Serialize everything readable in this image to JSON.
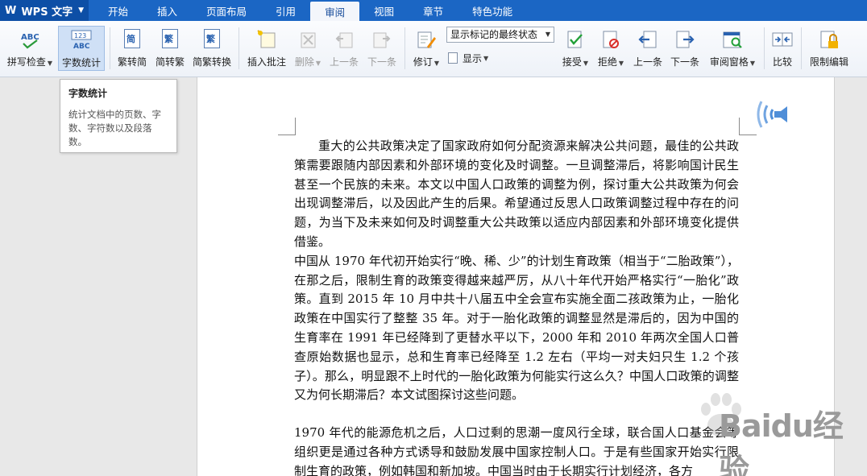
{
  "app": {
    "name": "WPS 文字",
    "logo": "W"
  },
  "menu_tabs": [
    {
      "label": "开始"
    },
    {
      "label": "插入"
    },
    {
      "label": "页面布局"
    },
    {
      "label": "引用"
    },
    {
      "label": "审阅"
    },
    {
      "label": "视图"
    },
    {
      "label": "章节"
    },
    {
      "label": "特色功能"
    }
  ],
  "active_tab": "审阅",
  "ribbon": {
    "spell_check": "拼写检查",
    "word_count": "字数统计",
    "trad_to_simp": "繁转简",
    "simp_to_trad": "简转繁",
    "conversion": "简繁转换",
    "insert_comment": "插入批注",
    "delete": "删除",
    "prev_comment": "上一条",
    "next_comment": "下一条",
    "track_changes": "修订",
    "markup_mode": "显示标记的最终状态",
    "show": "显示",
    "accept": "接受",
    "reject": "拒绝",
    "prev_change": "上一条",
    "next_change": "下一条",
    "review_pane": "审阅窗格",
    "compare": "比较",
    "restrict_edit": "限制编辑",
    "icon_abc": "ABC",
    "icon_123": "123",
    "icon_jian": "简",
    "icon_fan": "繁"
  },
  "tooltip": {
    "title": "字数统计",
    "body": "统计文档中的页数、字数、字符数以及段落数。"
  },
  "document": {
    "paragraphs": [
      "重大的公共政策决定了国家政府如何分配资源来解决公共问题，最佳的公共政策需要跟随内部因素和外部环境的变化及时调整。一旦调整滞后，将影响国计民生甚至一个民族的未来。本文以中国人口政策的调整为例，探讨重大公共政策为何会出现调整滞后，以及因此产生的后果。希望通过反思人口政策调整过程中存在的问题，为当下及未来如何及时调整重大公共政策以适应内部因素和外部环境变化提供借鉴。",
      "中国从 1970 年代初开始实行“晚、稀、少”的计划生育政策（相当于“二胎政策”），在那之后，限制生育的政策变得越来越严厉，从八十年代开始严格实行“一胎化”政策。直到 2015 年 10 月中共十八届五中全会宣布实施全面二孩政策为止，一胎化政策在中国实行了整整 35 年。对于一胎化政策的调整显然是滞后的，因为中国的生育率在 1991 年已经降到了更替水平以下，2000 年和 2010 年两次全国人口普查原始数据也显示，总和生育率已经降至 1.2 左右（平均一对夫妇只生 1.2 个孩子）。那么，明显跟不上时代的一胎化政策为何能实行这么久？中国人口政策的调整又为何长期滞后？本文试图探讨这些问题。",
      "1970 年代的能源危机之后，人口过剩的思潮一度风行全球，联合国人口基金会等组织更是通过各种方式诱导和鼓励发展中国家控制人口。于是有些国家开始实行限制生育的政策，例如韩国和新加坡。中国当时由于长期实行计划经济，各方"
    ]
  },
  "watermark": {
    "text": "Baidu经验"
  },
  "colors": {
    "menubar": "#1b66c4",
    "app_button": "#0d4fa6",
    "accent": "#2a62b0"
  }
}
